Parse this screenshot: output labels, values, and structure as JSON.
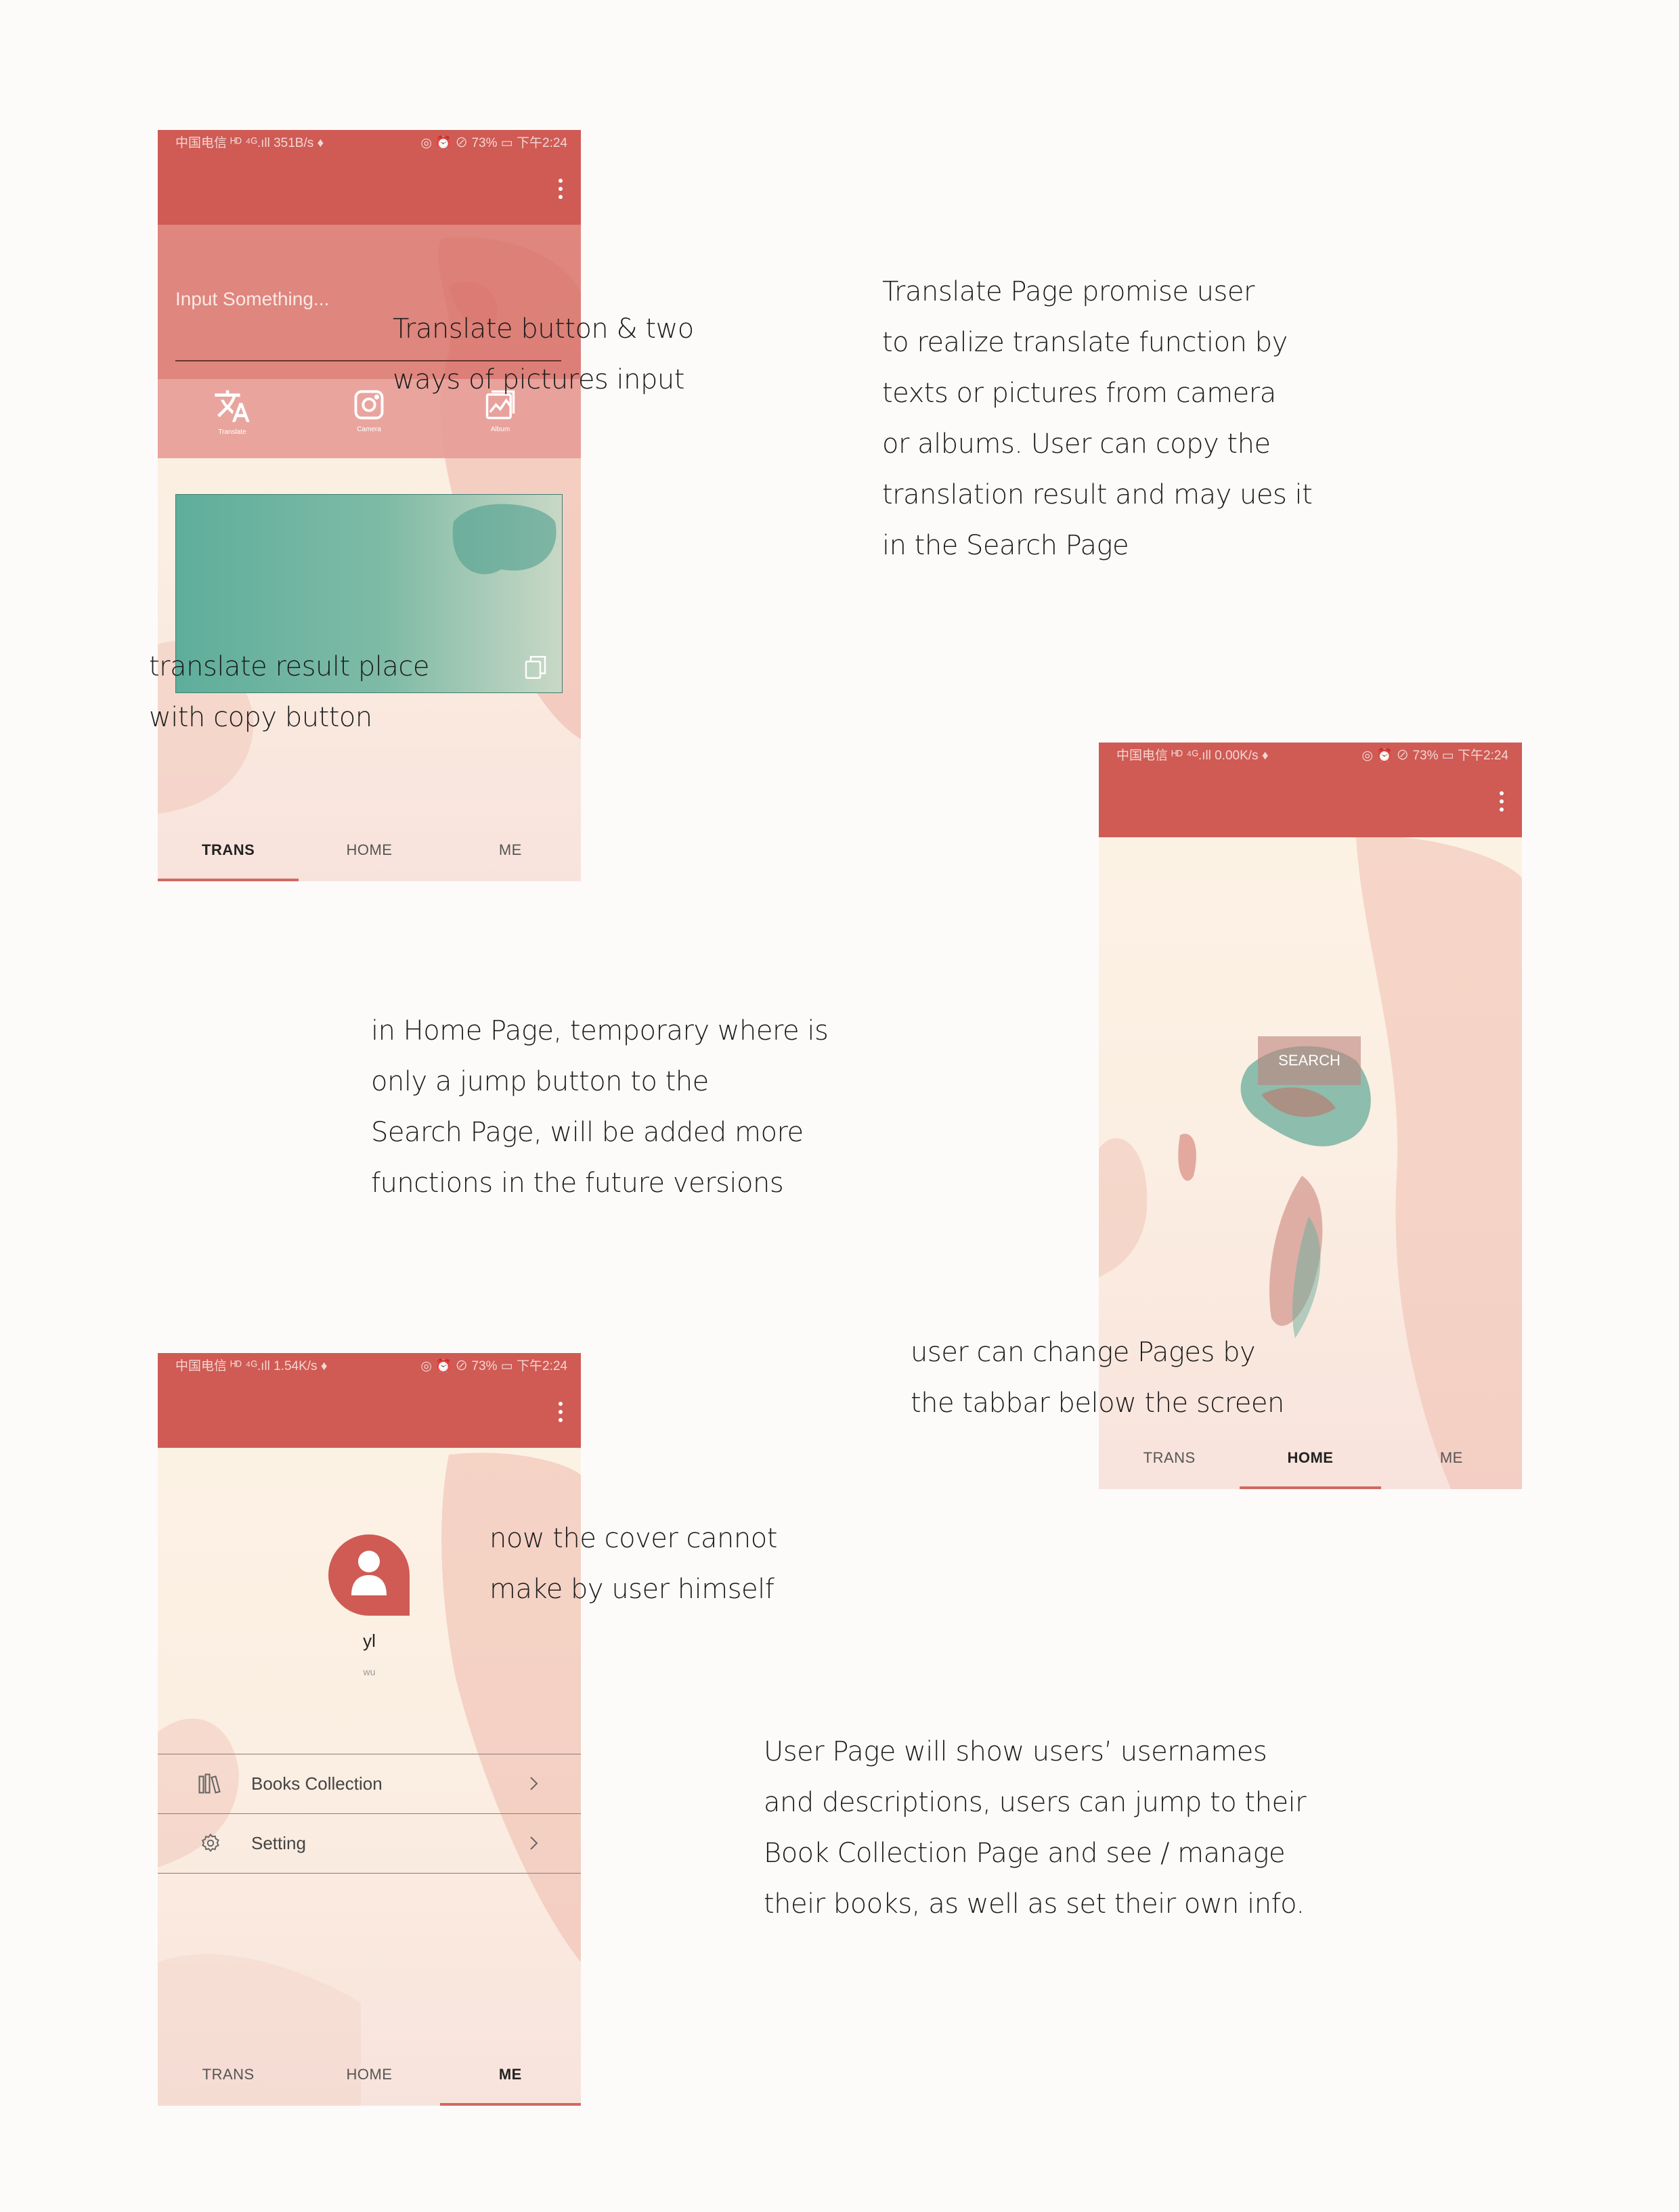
{
  "phones": {
    "translate": {
      "status_left": "中国电信 ᴴᴰ ⁴ᴳ.ıll 351B/s ♦",
      "status_right": "◎ ⏰ ⊘ 73% ▭ 下午2:24",
      "input_placeholder": "Input Something...",
      "actions": [
        {
          "icon": "translate-icon",
          "label": "Translate"
        },
        {
          "icon": "camera-icon",
          "label": "Camera"
        },
        {
          "icon": "album-icon",
          "label": "Album"
        }
      ],
      "copy_icon": "copy-icon",
      "tabs": [
        "TRANS",
        "HOME",
        "ME"
      ],
      "active_tab": "TRANS"
    },
    "home": {
      "status_left": "中国电信 ᴴᴰ ⁴ᴳ.ıll 0.00K/s ♦",
      "status_right": "◎ ⏰ ⊘ 73% ▭ 下午2:24",
      "search_label": "SEARCH",
      "tabs": [
        "TRANS",
        "HOME",
        "ME"
      ],
      "active_tab": "HOME"
    },
    "me": {
      "status_left": "中国电信 ᴴᴰ ⁴ᴳ.ıll 1.54K/s ♦",
      "status_right": "◎ ⏰ ⊘ 73% ▭ 下午2:24",
      "username": "yl",
      "description": "wu",
      "menu": [
        {
          "icon": "books-icon",
          "label": "Books Collection"
        },
        {
          "icon": "gear-icon",
          "label": "Setting"
        }
      ],
      "tabs": [
        "TRANS",
        "HOME",
        "ME"
      ],
      "active_tab": "ME"
    }
  },
  "colors": {
    "primary": "#cf5b54",
    "background": "#fcf3e5",
    "teal": "#5fae9c"
  },
  "annotations": {
    "translate_buttons": [
      "Translate button & two",
      "ways of pictures input"
    ],
    "result_place": [
      "translate result place",
      "with copy button"
    ],
    "translate_page": [
      "Translate Page promise user",
      "to realize translate function by",
      "texts or pictures from camera",
      "or albums. User can copy the",
      "translation result and may ues it",
      "in the Search Page"
    ],
    "home_page": [
      "in Home Page, temporary where is",
      "only a jump button to the",
      "Search Page, will be added more",
      "functions in the future versions"
    ],
    "tabbar": [
      "user can change Pages by",
      "the tabbar below the screen"
    ],
    "cover": [
      "now the cover cannot",
      "make by user himself"
    ],
    "user_page": [
      "User Page will show users’ usernames",
      "and descriptions, users can jump to their",
      "Book Collection Page and see / manage",
      "their books, as well as set their own info."
    ]
  }
}
